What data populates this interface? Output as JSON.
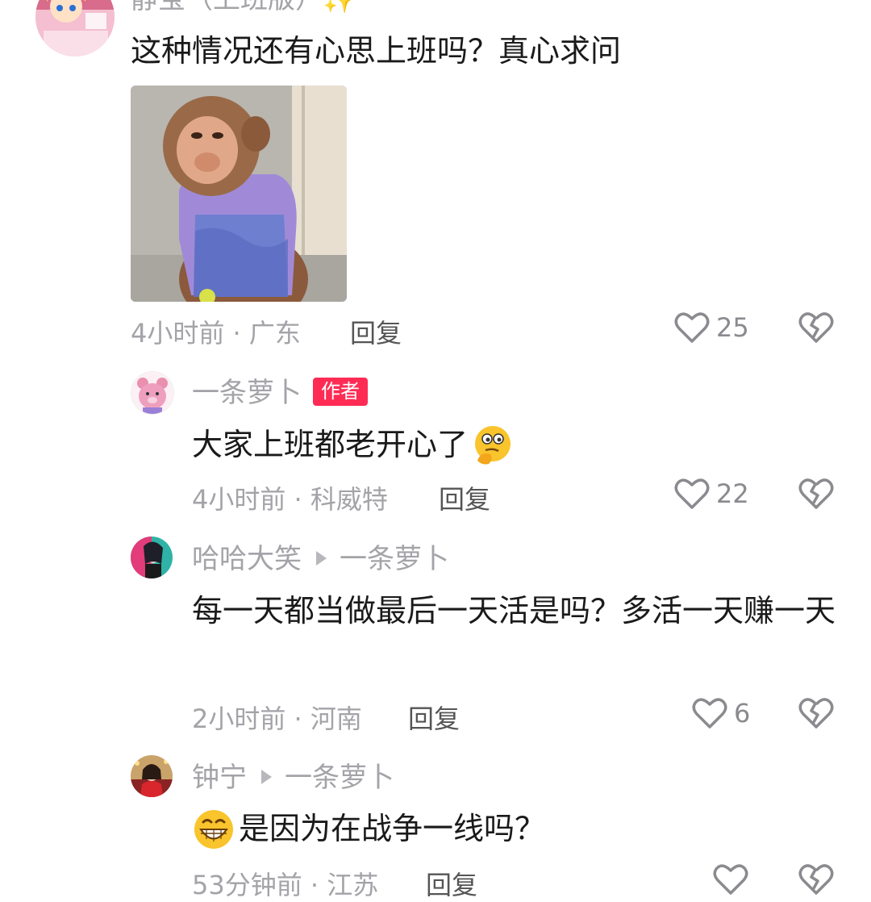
{
  "comments": [
    {
      "name": "静宝（上班版）",
      "name_emoji": "✨",
      "text": "这种情况还有心思上班吗？真心求问",
      "time": "4小时前",
      "location": "广东",
      "reply_label": "回复",
      "likes": "25"
    },
    {
      "name": "一条萝卜",
      "badge": "作者",
      "text": "大家上班都老开心了",
      "time": "4小时前",
      "location": "科威特",
      "reply_label": "回复",
      "likes": "22"
    },
    {
      "name": "哈哈大笑",
      "reply_to": "一条萝卜",
      "text": "每一天都当做最后一天活是吗？多活一天赚一天",
      "time": "2小时前",
      "location": "河南",
      "reply_label": "回复",
      "likes": "6"
    },
    {
      "name": "钟宁",
      "reply_to": "一条萝卜",
      "text": "是因为在战争一线吗？",
      "time": "53分钟前",
      "location": "江苏",
      "reply_label": "回复",
      "likes": ""
    }
  ],
  "meta_separator": " · ",
  "icons": {
    "like": "heart-outline-icon",
    "dislike": "broken-heart-icon",
    "emoji_thinking": "thinking-emoji-icon",
    "emoji_grin": "grin-emoji-icon",
    "arrow": "reply-arrow-icon"
  },
  "colors": {
    "name": "#a3a3a8",
    "text": "#1a1a1a",
    "badge": "#fe2c55",
    "icon": "#8a8a8f"
  }
}
